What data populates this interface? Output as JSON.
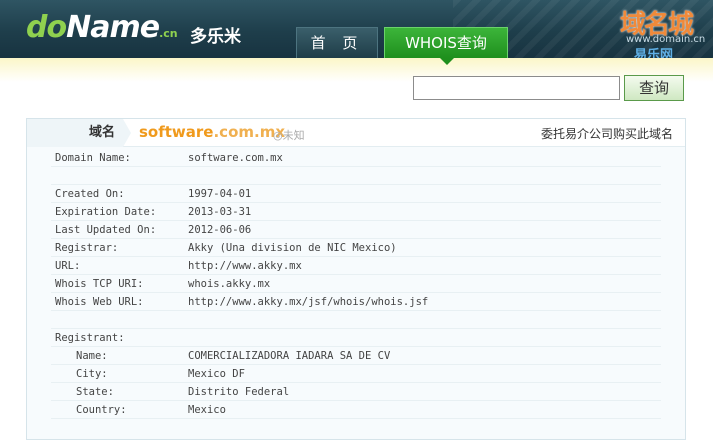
{
  "header": {
    "logo_do": "do",
    "logo_name": "Name",
    "logo_cn": ".cn",
    "brand_cn": "多乐米",
    "tabs": [
      {
        "label": "首 页",
        "active": false
      },
      {
        "label": "WHOIS查询",
        "active": true
      }
    ],
    "watermark": {
      "title": "域名城",
      "url": "www.domain.cn",
      "sub": "易乐网"
    }
  },
  "search": {
    "value": "",
    "button_label": "查询"
  },
  "panel": {
    "label": "域名",
    "domain_name": "software",
    "domain_suffix": ".com.mx",
    "status": "未知",
    "right_link": "委托易介公司购买此域名"
  },
  "whois": [
    {
      "key": "Domain Name:",
      "value": "software.com.mx",
      "indent": false
    },
    {
      "key": "",
      "value": "",
      "indent": false
    },
    {
      "key": "Created On:",
      "value": "1997-04-01",
      "indent": false
    },
    {
      "key": "Expiration Date:",
      "value": "2013-03-31",
      "indent": false
    },
    {
      "key": "Last Updated On:",
      "value": "2012-06-06",
      "indent": false
    },
    {
      "key": "Registrar:",
      "value": "Akky (Una division de NIC Mexico)",
      "indent": false
    },
    {
      "key": "URL:",
      "value": "http://www.akky.mx",
      "indent": false
    },
    {
      "key": "Whois TCP URI:",
      "value": "whois.akky.mx",
      "indent": false
    },
    {
      "key": "Whois Web URL:",
      "value": "http://www.akky.mx/jsf/whois/whois.jsf",
      "indent": false
    },
    {
      "key": "",
      "value": "",
      "indent": false
    },
    {
      "key": "Registrant:",
      "value": "",
      "indent": false
    },
    {
      "key": "Name:",
      "value": "COMERCIALIZADORA IADARA SA DE CV",
      "indent": true
    },
    {
      "key": "City:",
      "value": "Mexico DF",
      "indent": true
    },
    {
      "key": "State:",
      "value": "Distrito Federal",
      "indent": true
    },
    {
      "key": "Country:",
      "value": "Mexico",
      "indent": true
    }
  ],
  "colors": {
    "accent_green": "#1f8f1d",
    "domain_orange": "#f09a1c",
    "header_dark": "#1e3e4b"
  }
}
